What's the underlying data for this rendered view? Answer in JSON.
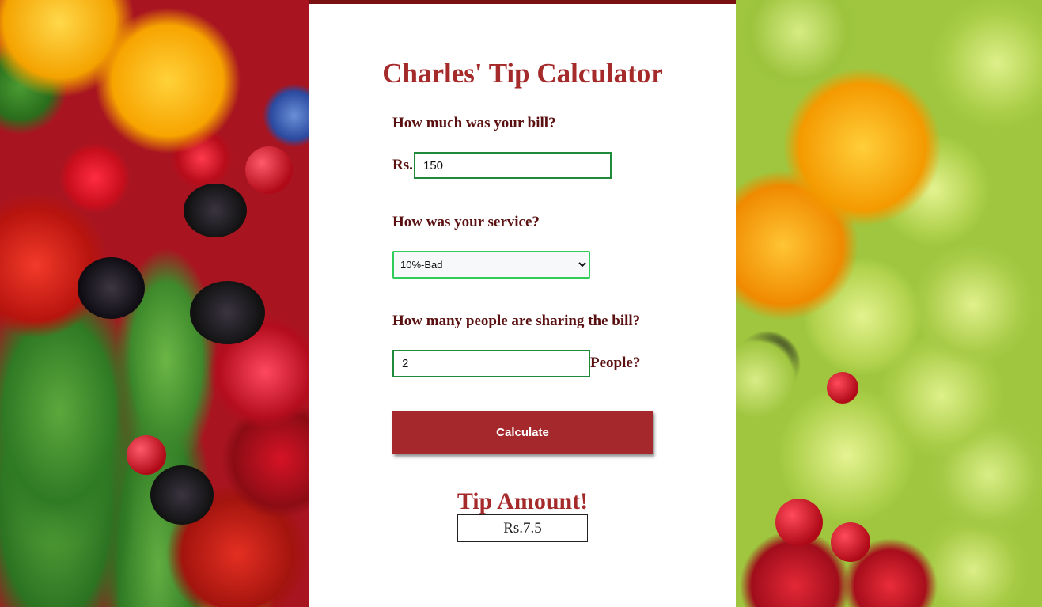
{
  "page": {
    "title": "Charles' Tip Calculator"
  },
  "bill": {
    "question": "How much was your bill?",
    "prefix": "Rs.",
    "value": "150"
  },
  "service": {
    "question": "How was your service?",
    "selected": "10%-Bad",
    "options": [
      "10%-Bad"
    ]
  },
  "people": {
    "question": "How many people are sharing the bill?",
    "value": "2",
    "suffix": "People?"
  },
  "calculate": {
    "label": "Calculate"
  },
  "result": {
    "heading": "Tip Amount!",
    "value": "Rs.7.5"
  },
  "colors": {
    "title": "#a52a2a",
    "label": "#5a1010",
    "button": "#a5282c",
    "input_border": "#1f8a3a",
    "select_border": "#2fcc5a"
  }
}
